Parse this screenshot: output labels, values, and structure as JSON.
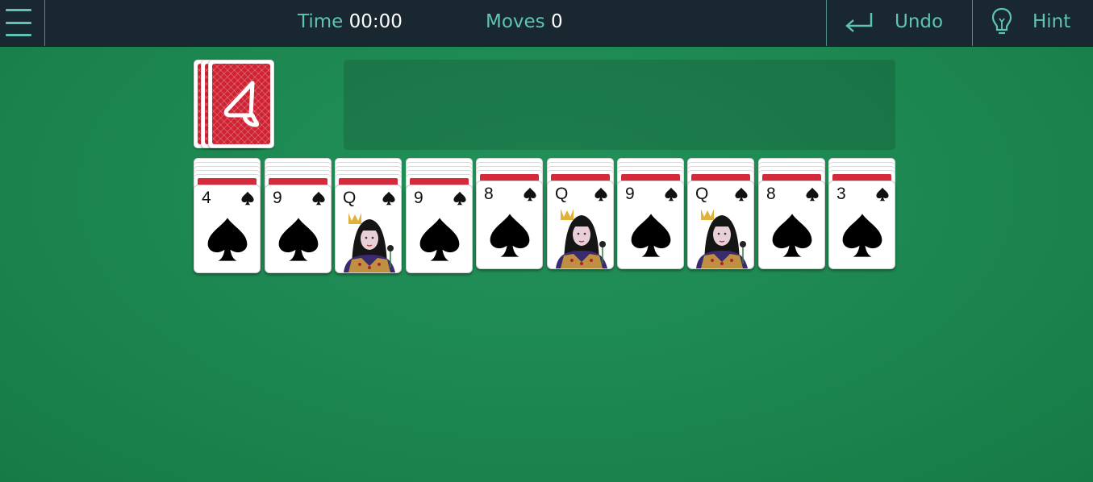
{
  "topbar": {
    "menu_icon": "hamburger-menu-icon",
    "time_label": "Time",
    "time_value": "00:00",
    "moves_label": "Moves",
    "moves_value": "0",
    "undo_label": "Undo",
    "undo_icon": "return-arrow-icon",
    "hint_label": "Hint",
    "hint_icon": "lightbulb-icon"
  },
  "colors": {
    "felt": "#1f8a52",
    "bar": "#182730",
    "accent": "#5fc3b5",
    "card_back": "#cf2233"
  },
  "stock": {
    "icon": "card-back-logo-icon"
  },
  "tableau": [
    {
      "rank": "4",
      "suit": "spades",
      "hidden": 5
    },
    {
      "rank": "9",
      "suit": "spades",
      "hidden": 5
    },
    {
      "rank": "Q",
      "suit": "spades",
      "hidden": 5
    },
    {
      "rank": "9",
      "suit": "spades",
      "hidden": 5
    },
    {
      "rank": "8",
      "suit": "spades",
      "hidden": 4
    },
    {
      "rank": "Q",
      "suit": "spades",
      "hidden": 4
    },
    {
      "rank": "9",
      "suit": "spades",
      "hidden": 4
    },
    {
      "rank": "Q",
      "suit": "spades",
      "hidden": 4
    },
    {
      "rank": "8",
      "suit": "spades",
      "hidden": 4
    },
    {
      "rank": "3",
      "suit": "spades",
      "hidden": 4
    }
  ]
}
